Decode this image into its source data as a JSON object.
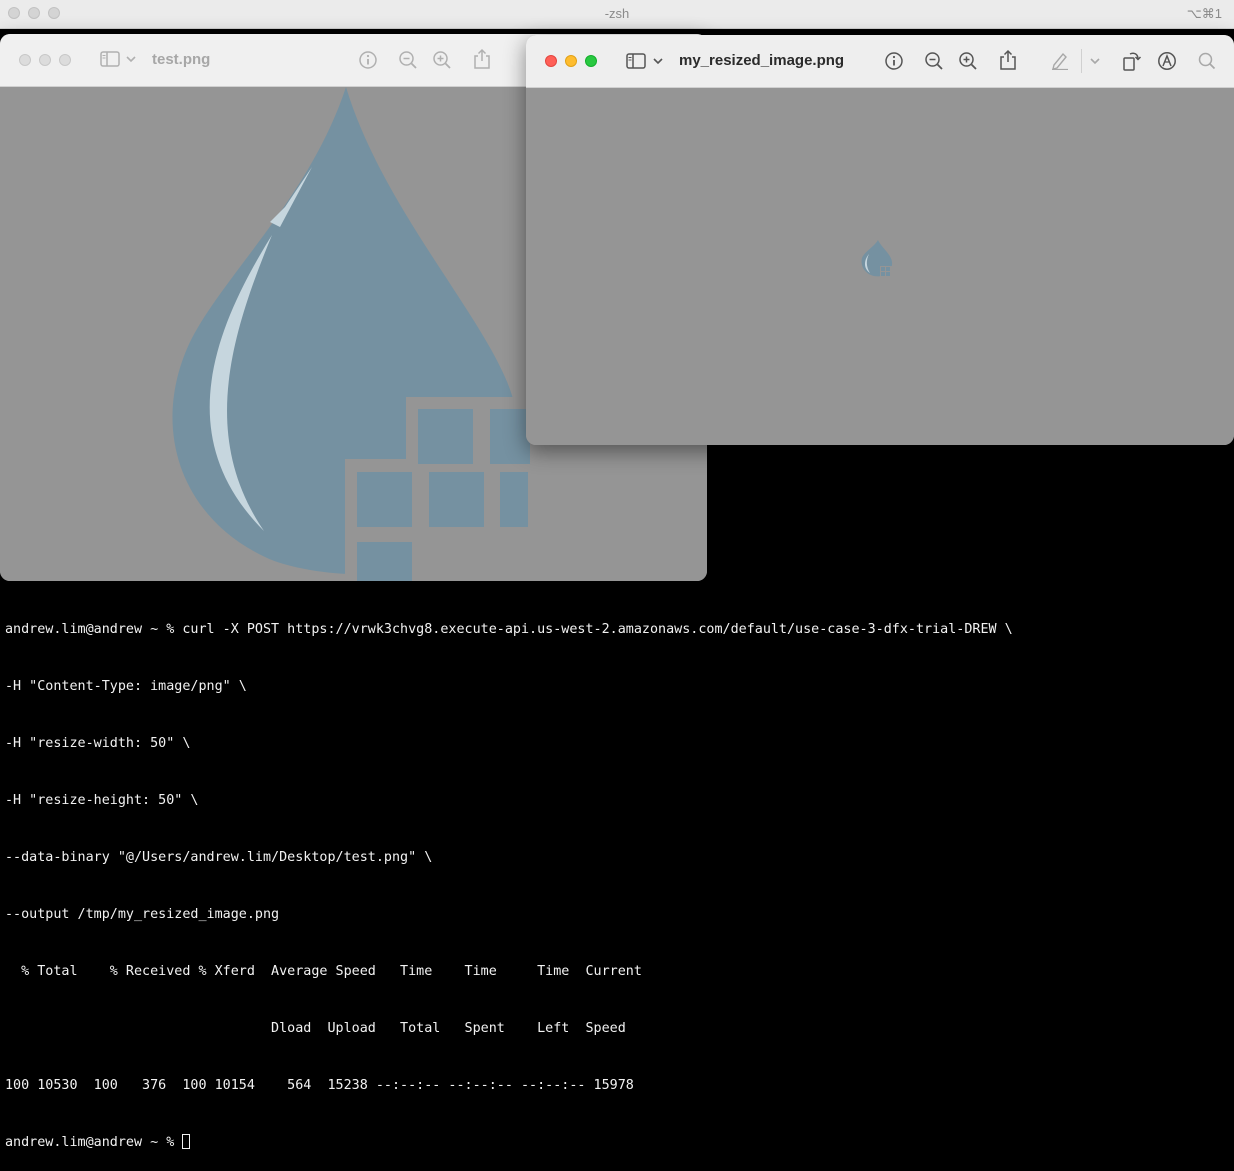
{
  "terminal_window": {
    "title": "-zsh",
    "shortcut": "⌥⌘1",
    "lines": [
      "andrew.lim@andrew ~ % curl -X POST https://vrwk3chvg8.execute-api.us-west-2.amazonaws.com/default/use-case-3-dfx-trial-DREW \\",
      "-H \"Content-Type: image/png\" \\",
      "-H \"resize-width: 50\" \\",
      "-H \"resize-height: 50\" \\",
      "--data-binary \"@/Users/andrew.lim/Desktop/test.png\" \\",
      "--output /tmp/my_resized_image.png",
      "  % Total    % Received % Xferd  Average Speed   Time    Time     Time  Current",
      "                                 Dload  Upload   Total   Spent    Left  Speed",
      "100 10530  100   376  100 10154    564  15238 --:--:-- --:--:-- --:--:-- 15978"
    ],
    "prompt": "andrew.lim@andrew ~ % "
  },
  "preview_back": {
    "filename": "test.png",
    "icons": [
      "sidebar-icon",
      "chevron-down-icon",
      "info-icon",
      "zoom-out-icon",
      "zoom-in-icon",
      "share-icon"
    ]
  },
  "preview_front": {
    "filename": "my_resized_image.png",
    "icons": [
      "sidebar-icon",
      "chevron-down-icon",
      "info-icon",
      "zoom-out-icon",
      "zoom-in-icon",
      "share-icon",
      "markup-icon",
      "chevron-down-icon",
      "rotate-icon",
      "annotate-icon",
      "search-icon"
    ]
  },
  "colors": {
    "terminal_bg": "#000000",
    "terminal_text": "#f2f2f2",
    "preview_canvas": "#959595",
    "drop_fill": "#7591a1",
    "drop_highlight": "#c6d6de"
  }
}
